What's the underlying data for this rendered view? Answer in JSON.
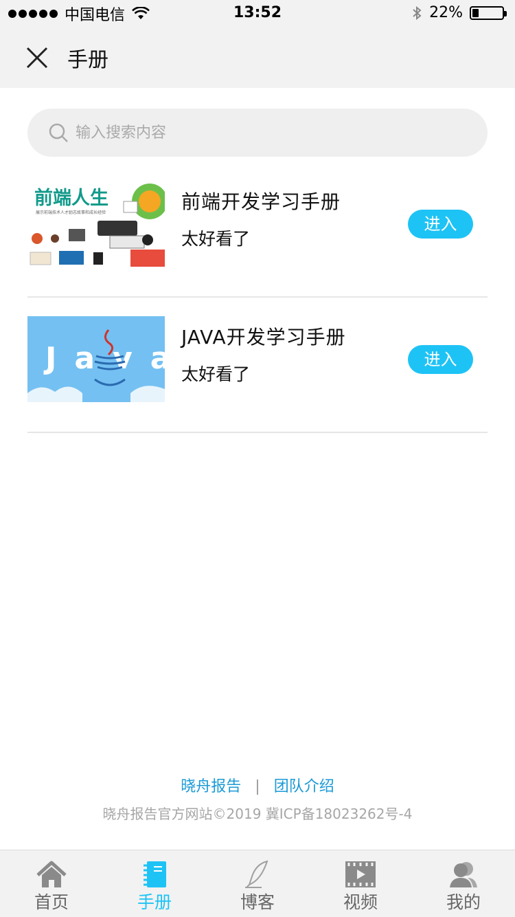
{
  "status_bar": {
    "carrier": "中国电信",
    "time": "13:52",
    "battery": "22%",
    "battery_level": 0.22
  },
  "nav": {
    "title": "手册"
  },
  "search": {
    "placeholder": "输入搜索内容",
    "value": ""
  },
  "items": [
    {
      "title": "前端开发学习手册",
      "desc": "太好看了",
      "button": "进入",
      "thumb_text": "前端人生",
      "thumb_subtext": "展示前端技术人才励志故事和成长经验"
    },
    {
      "title": "JAVA开发学习手册",
      "desc": "太好看了",
      "button": "进入",
      "thumb_text": "Java"
    }
  ],
  "footer": {
    "link1": "晓舟报告",
    "separator": "|",
    "link2": "团队介绍",
    "copyright": "晓舟报告官方网站©2019 冀ICP备18023262号-4"
  },
  "tabs": [
    {
      "label": "首页",
      "icon": "home-icon"
    },
    {
      "label": "手册",
      "icon": "notebook-icon",
      "active": true
    },
    {
      "label": "博客",
      "icon": "quill-icon"
    },
    {
      "label": "视频",
      "icon": "film-icon"
    },
    {
      "label": "我的",
      "icon": "user-icon"
    }
  ],
  "colors": {
    "accent": "#1ec3f5",
    "link": "#1a9ad6",
    "bar_background": "#f2f2f2"
  }
}
